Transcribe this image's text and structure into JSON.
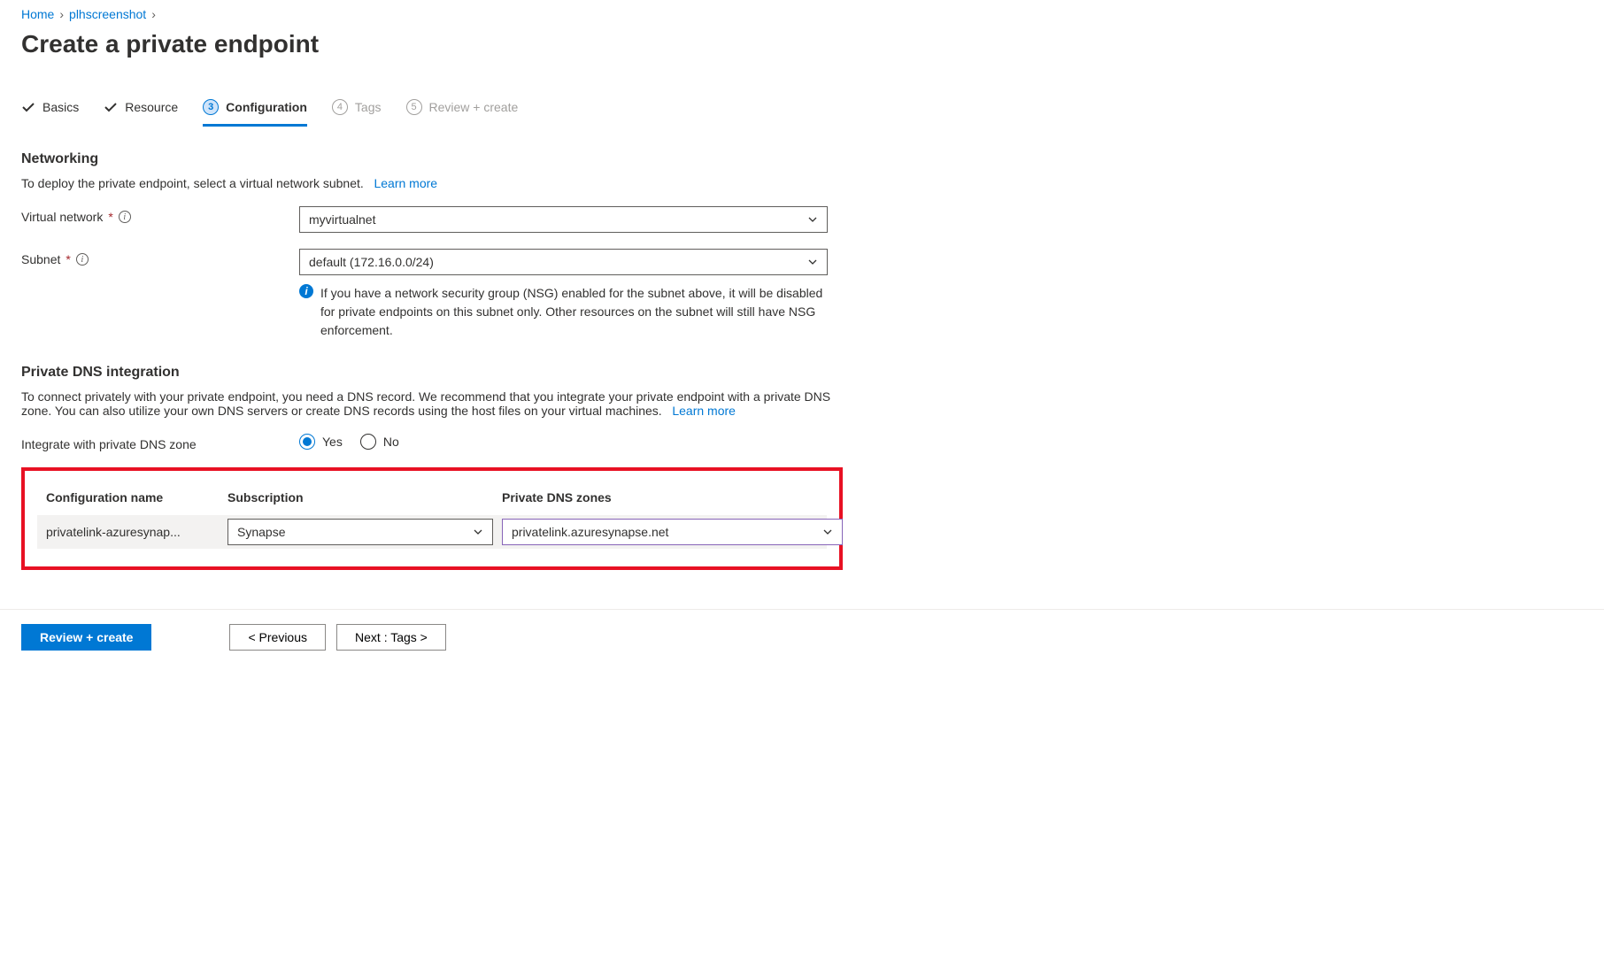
{
  "breadcrumb": {
    "home": "Home",
    "item": "plhscreenshot"
  },
  "title": "Create a private endpoint",
  "tabs": {
    "basics": "Basics",
    "resource": "Resource",
    "configuration": "Configuration",
    "tags_num": "4",
    "tags": "Tags",
    "review_num": "5",
    "review": "Review + create",
    "config_num": "3"
  },
  "networking": {
    "heading": "Networking",
    "desc": "To deploy the private endpoint, select a virtual network subnet.",
    "learn": "Learn more",
    "vnet_label": "Virtual network",
    "vnet_value": "myvirtualnet",
    "subnet_label": "Subnet",
    "subnet_value": "default (172.16.0.0/24)",
    "nsg_note": "If you have a network security group (NSG) enabled for the subnet above, it will be disabled for private endpoints on this subnet only. Other resources on the subnet will still have NSG enforcement."
  },
  "dns": {
    "heading": "Private DNS integration",
    "desc": "To connect privately with your private endpoint, you need a DNS record. We recommend that you integrate your private endpoint with a private DNS zone. You can also utilize your own DNS servers or create DNS records using the host files on your virtual machines.",
    "learn": "Learn more",
    "integrate_label": "Integrate with private DNS zone",
    "yes": "Yes",
    "no": "No",
    "col_config": "Configuration name",
    "col_sub": "Subscription",
    "col_zones": "Private DNS zones",
    "row_config": "privatelink-azuresynap...",
    "row_sub": "Synapse",
    "row_zone": "privatelink.azuresynapse.net"
  },
  "footer": {
    "review": "Review + create",
    "prev": "< Previous",
    "next": "Next : Tags >"
  }
}
